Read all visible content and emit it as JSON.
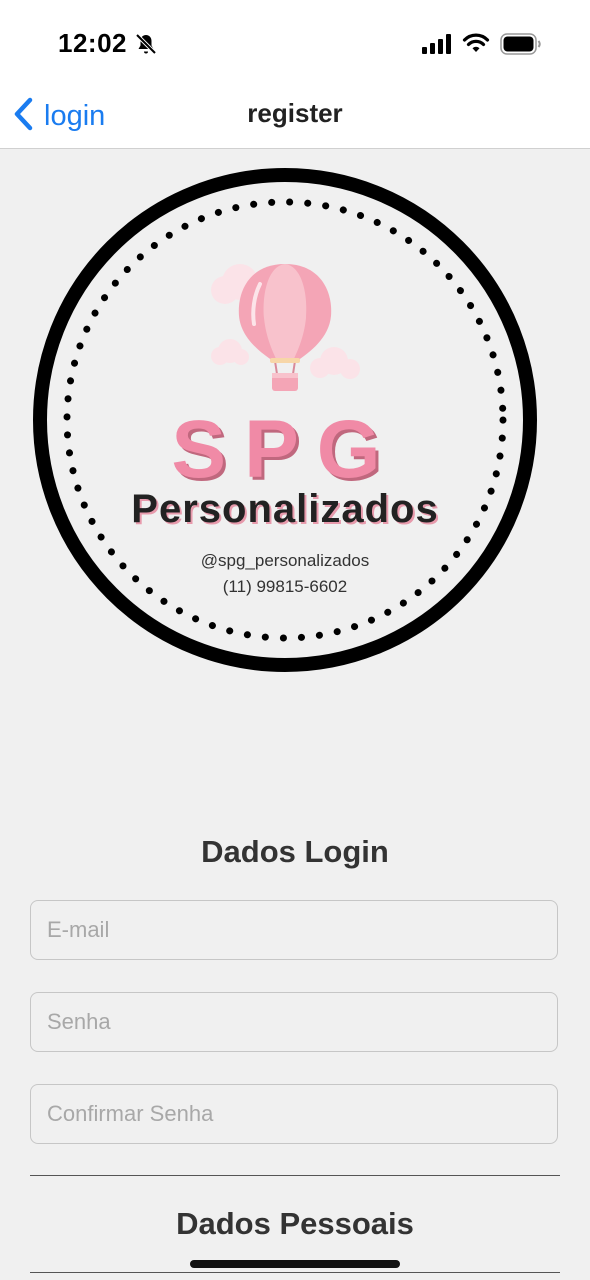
{
  "status_bar": {
    "time": "12:02",
    "icons": [
      "bell-slash-icon",
      "signal-icon",
      "wifi-icon",
      "battery-icon"
    ]
  },
  "nav": {
    "back_label": "login",
    "title": "register",
    "accent_color": "#1a7cf0"
  },
  "logo": {
    "brand": "SPG",
    "subtitle": "Personalizados",
    "handle": "@spg_personalizados",
    "phone": "(11) 99815-6602",
    "brand_color": "#f08aa6"
  },
  "sections": {
    "login_title": "Dados Login",
    "personal_title": "Dados Pessoais"
  },
  "fields": {
    "email_placeholder": "E-mail",
    "password_placeholder": "Senha",
    "confirm_placeholder": "Confirmar Senha"
  }
}
